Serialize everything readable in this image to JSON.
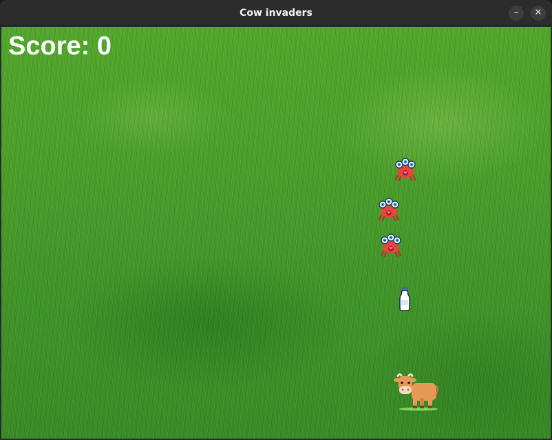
{
  "window": {
    "title": "Cow invaders",
    "minimize_label": "–",
    "close_label": "✕"
  },
  "game": {
    "score_text": "Score: 0",
    "background": "grass-field",
    "invaders": [
      {
        "type": "red-crab-alien",
        "icon": "alien-crab-icon"
      },
      {
        "type": "red-crab-alien",
        "icon": "alien-crab-icon"
      },
      {
        "type": "red-crab-alien",
        "icon": "alien-crab-icon"
      }
    ],
    "projectile": {
      "type": "milk-bottle",
      "icon": "milk-bottle-icon"
    },
    "player": {
      "type": "cow",
      "icon": "cow-icon"
    }
  },
  "colors": {
    "invader": "#e8463b",
    "cow": "#e79a55",
    "score": "#ffffff"
  }
}
